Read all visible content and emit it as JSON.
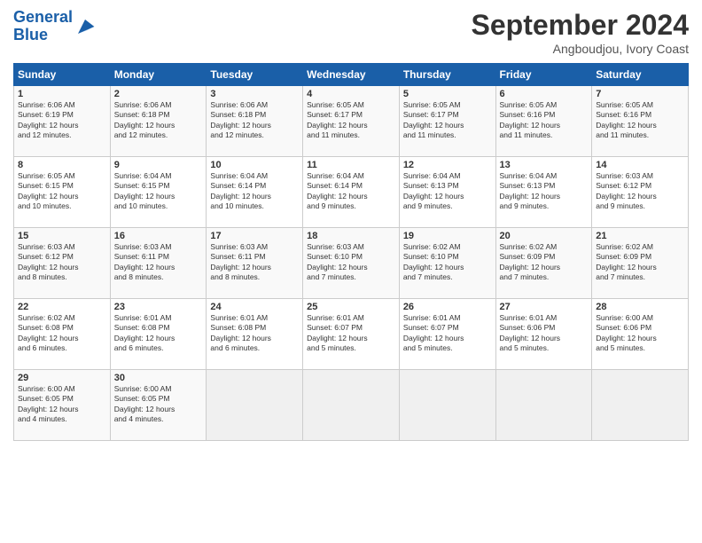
{
  "header": {
    "logo_line1": "General",
    "logo_line2": "Blue",
    "month": "September 2024",
    "location": "Angboudjou, Ivory Coast"
  },
  "weekdays": [
    "Sunday",
    "Monday",
    "Tuesday",
    "Wednesday",
    "Thursday",
    "Friday",
    "Saturday"
  ],
  "weeks": [
    [
      {
        "day": "1",
        "info": "Sunrise: 6:06 AM\nSunset: 6:19 PM\nDaylight: 12 hours\nand 12 minutes."
      },
      {
        "day": "2",
        "info": "Sunrise: 6:06 AM\nSunset: 6:18 PM\nDaylight: 12 hours\nand 12 minutes."
      },
      {
        "day": "3",
        "info": "Sunrise: 6:06 AM\nSunset: 6:18 PM\nDaylight: 12 hours\nand 12 minutes."
      },
      {
        "day": "4",
        "info": "Sunrise: 6:05 AM\nSunset: 6:17 PM\nDaylight: 12 hours\nand 11 minutes."
      },
      {
        "day": "5",
        "info": "Sunrise: 6:05 AM\nSunset: 6:17 PM\nDaylight: 12 hours\nand 11 minutes."
      },
      {
        "day": "6",
        "info": "Sunrise: 6:05 AM\nSunset: 6:16 PM\nDaylight: 12 hours\nand 11 minutes."
      },
      {
        "day": "7",
        "info": "Sunrise: 6:05 AM\nSunset: 6:16 PM\nDaylight: 12 hours\nand 11 minutes."
      }
    ],
    [
      {
        "day": "8",
        "info": "Sunrise: 6:05 AM\nSunset: 6:15 PM\nDaylight: 12 hours\nand 10 minutes."
      },
      {
        "day": "9",
        "info": "Sunrise: 6:04 AM\nSunset: 6:15 PM\nDaylight: 12 hours\nand 10 minutes."
      },
      {
        "day": "10",
        "info": "Sunrise: 6:04 AM\nSunset: 6:14 PM\nDaylight: 12 hours\nand 10 minutes."
      },
      {
        "day": "11",
        "info": "Sunrise: 6:04 AM\nSunset: 6:14 PM\nDaylight: 12 hours\nand 9 minutes."
      },
      {
        "day": "12",
        "info": "Sunrise: 6:04 AM\nSunset: 6:13 PM\nDaylight: 12 hours\nand 9 minutes."
      },
      {
        "day": "13",
        "info": "Sunrise: 6:04 AM\nSunset: 6:13 PM\nDaylight: 12 hours\nand 9 minutes."
      },
      {
        "day": "14",
        "info": "Sunrise: 6:03 AM\nSunset: 6:12 PM\nDaylight: 12 hours\nand 9 minutes."
      }
    ],
    [
      {
        "day": "15",
        "info": "Sunrise: 6:03 AM\nSunset: 6:12 PM\nDaylight: 12 hours\nand 8 minutes."
      },
      {
        "day": "16",
        "info": "Sunrise: 6:03 AM\nSunset: 6:11 PM\nDaylight: 12 hours\nand 8 minutes."
      },
      {
        "day": "17",
        "info": "Sunrise: 6:03 AM\nSunset: 6:11 PM\nDaylight: 12 hours\nand 8 minutes."
      },
      {
        "day": "18",
        "info": "Sunrise: 6:03 AM\nSunset: 6:10 PM\nDaylight: 12 hours\nand 7 minutes."
      },
      {
        "day": "19",
        "info": "Sunrise: 6:02 AM\nSunset: 6:10 PM\nDaylight: 12 hours\nand 7 minutes."
      },
      {
        "day": "20",
        "info": "Sunrise: 6:02 AM\nSunset: 6:09 PM\nDaylight: 12 hours\nand 7 minutes."
      },
      {
        "day": "21",
        "info": "Sunrise: 6:02 AM\nSunset: 6:09 PM\nDaylight: 12 hours\nand 7 minutes."
      }
    ],
    [
      {
        "day": "22",
        "info": "Sunrise: 6:02 AM\nSunset: 6:08 PM\nDaylight: 12 hours\nand 6 minutes."
      },
      {
        "day": "23",
        "info": "Sunrise: 6:01 AM\nSunset: 6:08 PM\nDaylight: 12 hours\nand 6 minutes."
      },
      {
        "day": "24",
        "info": "Sunrise: 6:01 AM\nSunset: 6:08 PM\nDaylight: 12 hours\nand 6 minutes."
      },
      {
        "day": "25",
        "info": "Sunrise: 6:01 AM\nSunset: 6:07 PM\nDaylight: 12 hours\nand 5 minutes."
      },
      {
        "day": "26",
        "info": "Sunrise: 6:01 AM\nSunset: 6:07 PM\nDaylight: 12 hours\nand 5 minutes."
      },
      {
        "day": "27",
        "info": "Sunrise: 6:01 AM\nSunset: 6:06 PM\nDaylight: 12 hours\nand 5 minutes."
      },
      {
        "day": "28",
        "info": "Sunrise: 6:00 AM\nSunset: 6:06 PM\nDaylight: 12 hours\nand 5 minutes."
      }
    ],
    [
      {
        "day": "29",
        "info": "Sunrise: 6:00 AM\nSunset: 6:05 PM\nDaylight: 12 hours\nand 4 minutes."
      },
      {
        "day": "30",
        "info": "Sunrise: 6:00 AM\nSunset: 6:05 PM\nDaylight: 12 hours\nand 4 minutes."
      },
      {
        "day": "",
        "info": ""
      },
      {
        "day": "",
        "info": ""
      },
      {
        "day": "",
        "info": ""
      },
      {
        "day": "",
        "info": ""
      },
      {
        "day": "",
        "info": ""
      }
    ]
  ]
}
